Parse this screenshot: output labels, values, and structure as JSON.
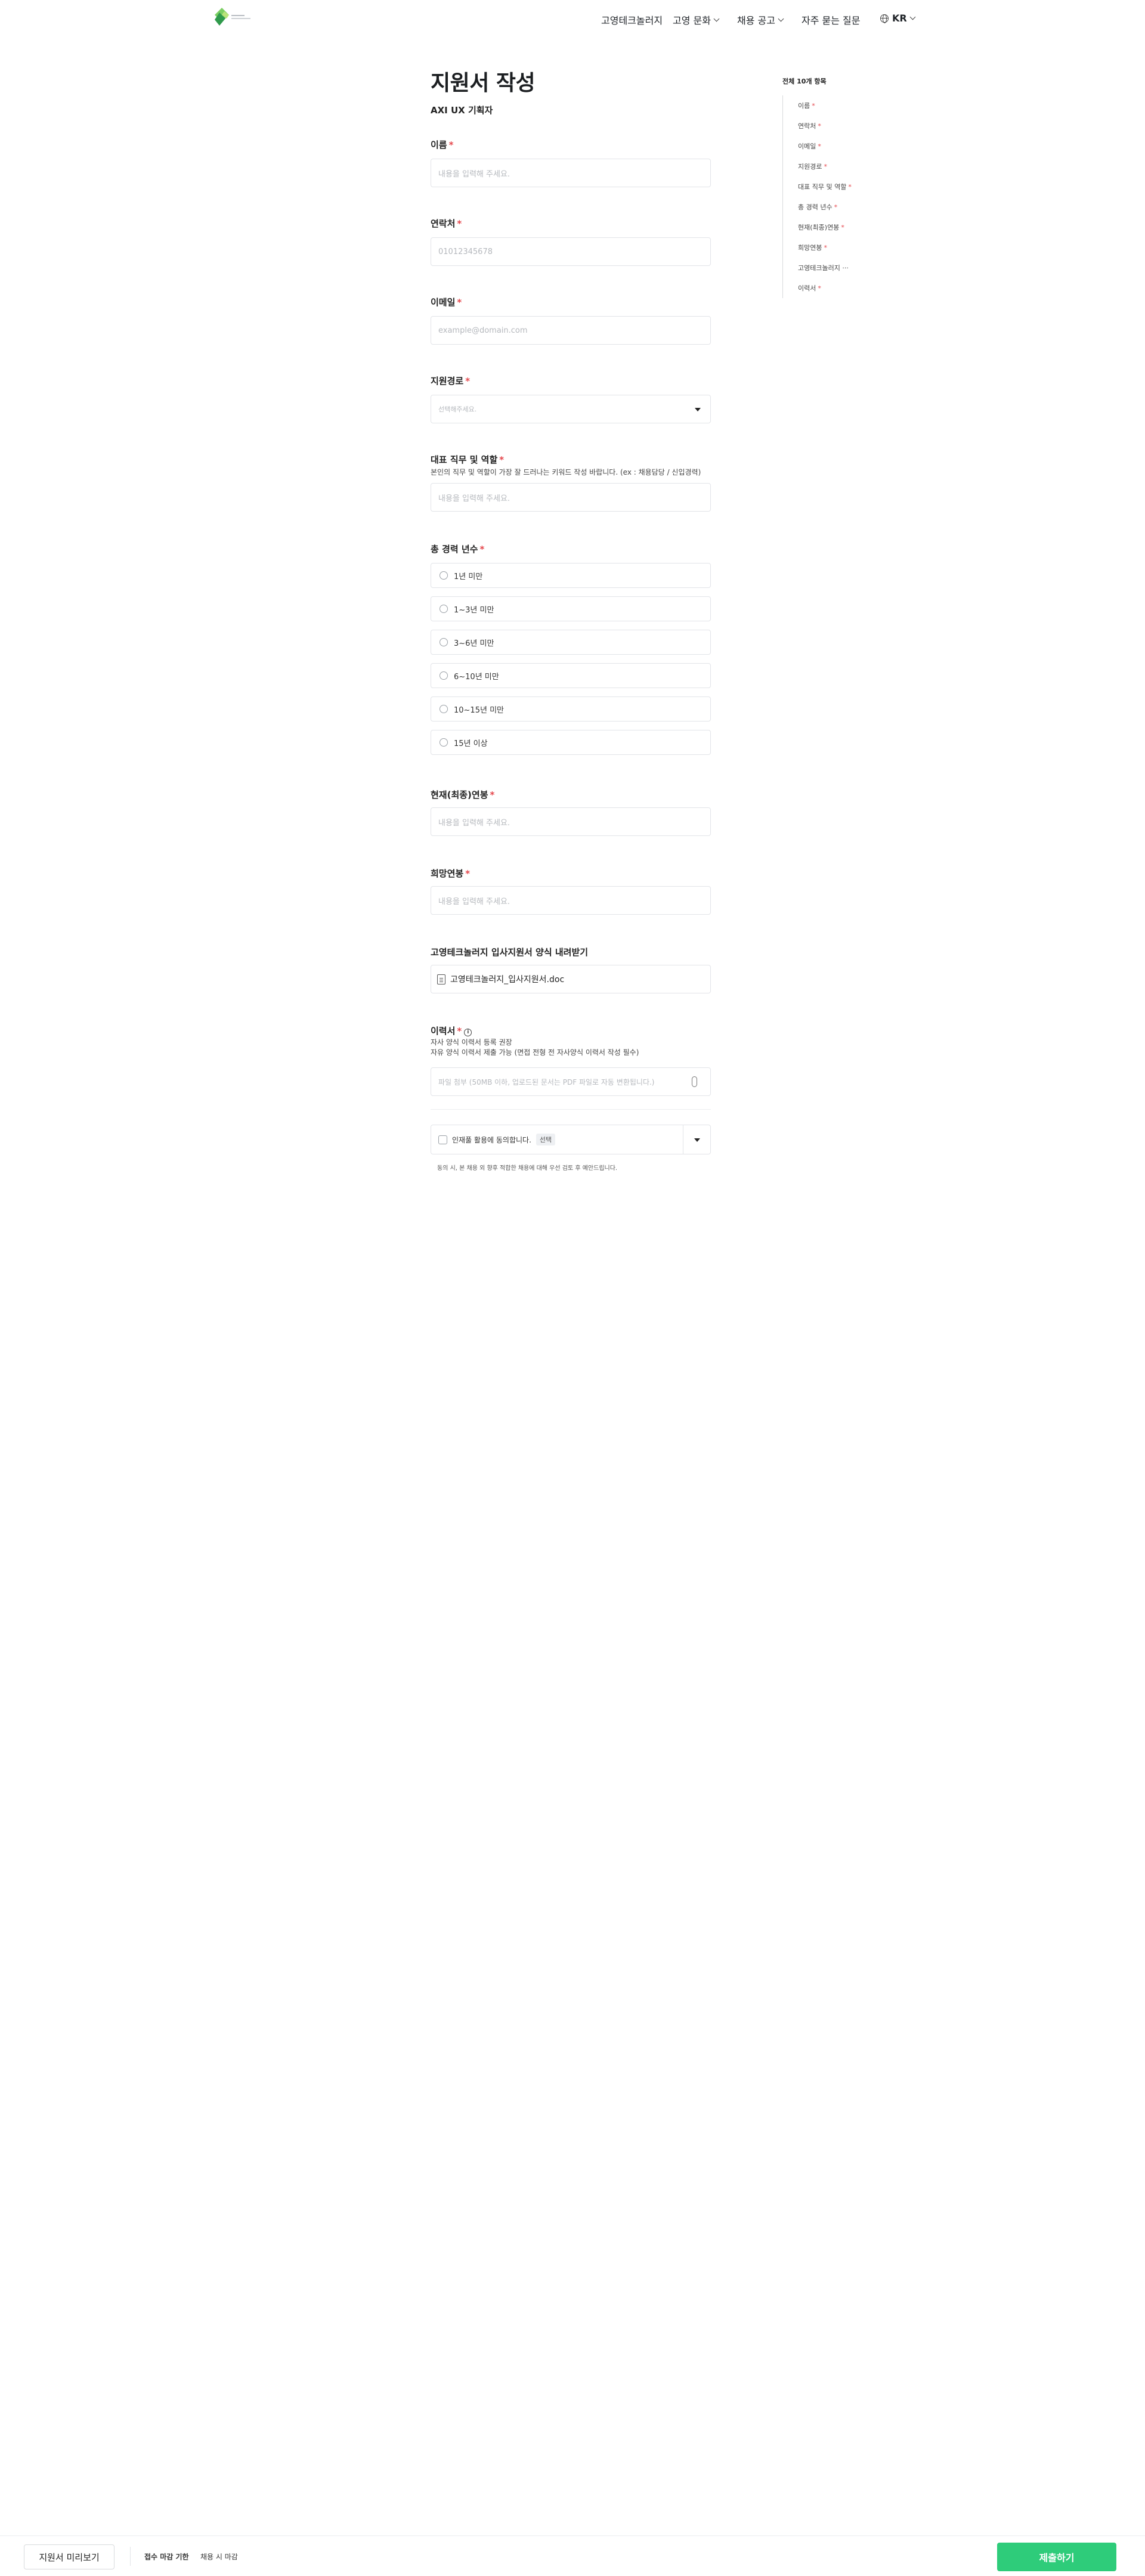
{
  "header": {
    "nav": [
      {
        "label": "고영테크놀러지",
        "dropdown": false
      },
      {
        "label": "고영 문화",
        "dropdown": true
      },
      {
        "label": "채용 공고",
        "dropdown": true
      },
      {
        "label": "자주 묻는 질문",
        "dropdown": false
      }
    ],
    "language": "KR"
  },
  "form": {
    "title": "지원서 작성",
    "subtitle": "AXI UX 기획자",
    "name": {
      "label": "이름",
      "placeholder": "내용을 입력해 주세요."
    },
    "phone": {
      "label": "연락처",
      "placeholder": "01012345678"
    },
    "email": {
      "label": "이메일",
      "placeholder": "example@domain.com"
    },
    "source": {
      "label": "지원경로",
      "placeholder": "선택해주세요."
    },
    "role": {
      "label": "대표 직무 및 역할",
      "help": "본인의 직무 및 역할이 가장 잘 드러나는 키워드 작성 바랍니다. (ex : 채용담당 / 신입경력)",
      "placeholder": "내용을 입력해 주세요."
    },
    "career": {
      "label": "총 경력 년수",
      "options": [
        "1년 미만",
        "1~3년 미만",
        "3~6년 미만",
        "6~10년 미만",
        "10~15년 미만",
        "15년 이상"
      ]
    },
    "current_salary": {
      "label": "현재(최종)연봉",
      "placeholder": "내용을 입력해 주세요."
    },
    "desired_salary": {
      "label": "희망연봉",
      "placeholder": "내용을 입력해 주세요."
    },
    "download": {
      "label": "고영테크놀러지 입사지원서 양식 내려받기",
      "file": "고영테크놀러지_입사지원서.doc"
    },
    "resume": {
      "label": "이력서",
      "help1": "자사 양식 이력서 등록 권장",
      "help2": "자유 양식 이력서 제출 가능 (면접 전형 전 자사양식 이력서 작성 필수)",
      "placeholder": "파일 첨부 (50MB 이하, 업로드된 문서는 PDF 파일로 자동 변환됩니다.)"
    },
    "consent": {
      "label": "인재풀 활용에 동의합니다.",
      "badge": "선택",
      "note": "동의 시, 본 채용 외 향후 적합한 채용에 대해 우선 검토 후 예안드립니다."
    }
  },
  "toc": {
    "title": "전체 10개 항목",
    "items": [
      {
        "label": "이름",
        "required": true
      },
      {
        "label": "연락처",
        "required": true
      },
      {
        "label": "이메일",
        "required": true
      },
      {
        "label": "지원경로",
        "required": true
      },
      {
        "label": "대표 직무 및 역할",
        "required": true
      },
      {
        "label": "총 경력 년수",
        "required": true
      },
      {
        "label": "현재(최종)연봉",
        "required": true
      },
      {
        "label": "희망연봉",
        "required": true
      },
      {
        "label": "고영테크놀러지 ···",
        "required": false
      },
      {
        "label": "이력서",
        "required": true
      }
    ]
  },
  "bottom": {
    "preview": "지원서 미리보기",
    "deadline_label": "접수 마감 기한",
    "deadline_value": "채용 시 마감",
    "submit": "제출하기"
  },
  "colors": {
    "accent": "#2ecc7a",
    "required": "#e5484d"
  }
}
